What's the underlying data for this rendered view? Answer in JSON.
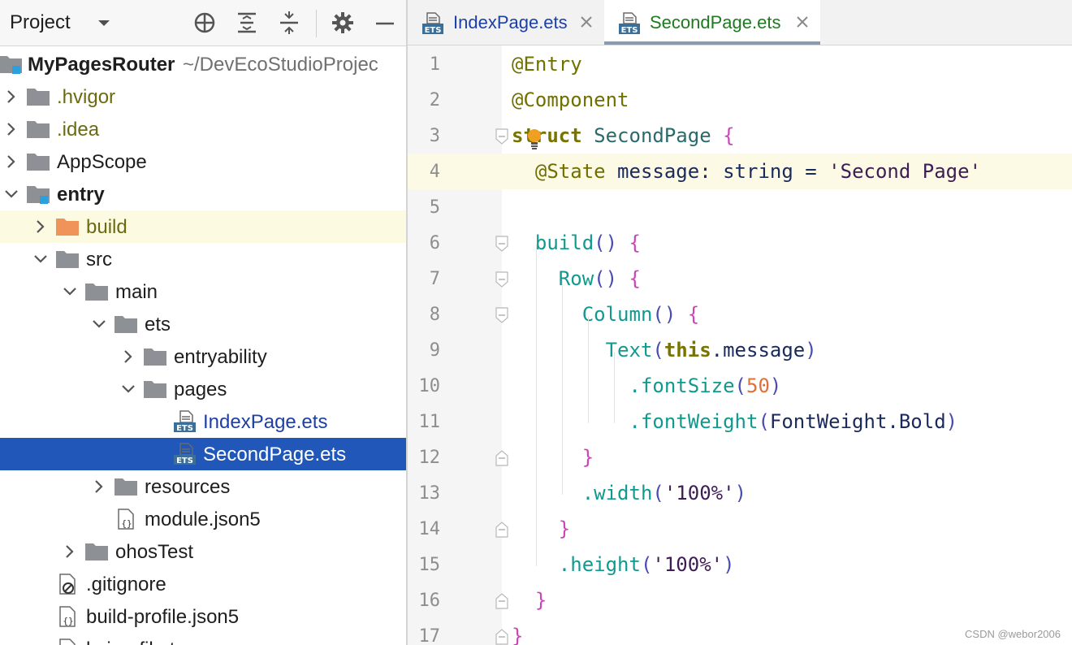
{
  "project_panel": {
    "title": "Project",
    "header_icons": [
      "crosshair-icon",
      "expand-all-icon",
      "collapse-all-icon",
      "gear-icon",
      "minimize-icon"
    ],
    "tree": [
      {
        "label": "MyPagesRouter",
        "path": "~/DevEcoStudioProjec",
        "depth": 0,
        "expanded": true,
        "icon": "module-folder-icon",
        "style": "bold"
      },
      {
        "label": ".hvigor",
        "depth": 1,
        "expanded": false,
        "icon": "folder-icon",
        "style": "olive"
      },
      {
        "label": ".idea",
        "depth": 1,
        "expanded": false,
        "icon": "folder-icon",
        "style": "olive"
      },
      {
        "label": "AppScope",
        "depth": 1,
        "expanded": false,
        "icon": "folder-icon",
        "style": "normal"
      },
      {
        "label": "entry",
        "depth": 1,
        "expanded": true,
        "icon": "module-folder-icon",
        "style": "bold"
      },
      {
        "label": "build",
        "depth": 2,
        "expanded": false,
        "icon": "build-folder-icon",
        "style": "olive",
        "highlight": true
      },
      {
        "label": "src",
        "depth": 2,
        "expanded": true,
        "icon": "folder-icon",
        "style": "normal"
      },
      {
        "label": "main",
        "depth": 3,
        "expanded": true,
        "icon": "folder-icon",
        "style": "normal"
      },
      {
        "label": "ets",
        "depth": 4,
        "expanded": true,
        "icon": "folder-icon",
        "style": "normal"
      },
      {
        "label": "entryability",
        "depth": 5,
        "expanded": false,
        "icon": "folder-icon",
        "style": "normal"
      },
      {
        "label": "pages",
        "depth": 5,
        "expanded": true,
        "icon": "folder-icon",
        "style": "normal"
      },
      {
        "label": "IndexPage.ets",
        "depth": 6,
        "icon": "ets-file-icon",
        "style": "blue"
      },
      {
        "label": "SecondPage.ets",
        "depth": 6,
        "icon": "ets-file-icon",
        "style": "normal",
        "selected": true
      },
      {
        "label": "resources",
        "depth": 4,
        "expanded": false,
        "icon": "folder-icon",
        "style": "normal"
      },
      {
        "label": "module.json5",
        "depth": 4,
        "icon": "json-file-icon",
        "style": "normal"
      },
      {
        "label": "ohosTest",
        "depth": 3,
        "expanded": false,
        "icon": "folder-icon",
        "style": "normal"
      },
      {
        "label": ".gitignore",
        "depth": 2,
        "icon": "gitignore-file-icon",
        "style": "normal"
      },
      {
        "label": "build-profile.json5",
        "depth": 2,
        "icon": "json-file-icon",
        "style": "normal"
      },
      {
        "label": "hvigorfile.ts",
        "depth": 2,
        "icon": "file-icon",
        "style": "normal"
      }
    ]
  },
  "editor": {
    "tabs": [
      {
        "label": "IndexPage.ets",
        "active": false
      },
      {
        "label": "SecondPage.ets",
        "active": true
      }
    ],
    "current_line": 4,
    "lines": [
      {
        "n": "1",
        "tokens": [
          [
            "dec",
            "@Entry"
          ]
        ]
      },
      {
        "n": "2",
        "tokens": [
          [
            "dec",
            "@Component"
          ]
        ]
      },
      {
        "n": "3",
        "fold": "open",
        "tokens": [
          [
            "kw",
            "struct"
          ],
          [
            "id",
            " "
          ],
          [
            "type",
            "SecondPage"
          ],
          [
            "id",
            " "
          ],
          [
            "br",
            "{"
          ]
        ]
      },
      {
        "n": "4",
        "tokens": [
          [
            "id",
            "  "
          ],
          [
            "dec",
            "@State"
          ],
          [
            "id",
            " message: "
          ],
          [
            "kw2",
            "string"
          ],
          [
            "id",
            " = "
          ],
          [
            "str",
            "'Second Page'"
          ]
        ]
      },
      {
        "n": "5",
        "tokens": []
      },
      {
        "n": "6",
        "fold": "open",
        "tokens": [
          [
            "id",
            "  "
          ],
          [
            "fn",
            "build"
          ],
          [
            "p",
            "()"
          ],
          [
            "id",
            " "
          ],
          [
            "br",
            "{"
          ]
        ]
      },
      {
        "n": "7",
        "fold": "open",
        "tokens": [
          [
            "id",
            "    "
          ],
          [
            "fn",
            "Row"
          ],
          [
            "p",
            "()"
          ],
          [
            "id",
            " "
          ],
          [
            "br",
            "{"
          ]
        ]
      },
      {
        "n": "8",
        "fold": "open",
        "tokens": [
          [
            "id",
            "      "
          ],
          [
            "fn",
            "Column"
          ],
          [
            "p",
            "()"
          ],
          [
            "id",
            " "
          ],
          [
            "br",
            "{"
          ]
        ]
      },
      {
        "n": "9",
        "tokens": [
          [
            "id",
            "        "
          ],
          [
            "fn",
            "Text"
          ],
          [
            "p",
            "("
          ],
          [
            "kw",
            "this"
          ],
          [
            "id",
            ".message"
          ],
          [
            "p",
            ")"
          ]
        ]
      },
      {
        "n": "10",
        "tokens": [
          [
            "id",
            "          "
          ],
          [
            "fn",
            ".fontSize"
          ],
          [
            "p",
            "("
          ],
          [
            "num",
            "50"
          ],
          [
            "p",
            ")"
          ]
        ]
      },
      {
        "n": "11",
        "tokens": [
          [
            "id",
            "          "
          ],
          [
            "fn",
            ".fontWeight"
          ],
          [
            "p",
            "("
          ],
          [
            "id",
            "FontWeight.Bold"
          ],
          [
            "p",
            ")"
          ]
        ]
      },
      {
        "n": "12",
        "fold": "close",
        "tokens": [
          [
            "id",
            "      "
          ],
          [
            "br",
            "}"
          ]
        ]
      },
      {
        "n": "13",
        "tokens": [
          [
            "id",
            "      "
          ],
          [
            "fn",
            ".width"
          ],
          [
            "p",
            "("
          ],
          [
            "str",
            "'100%'"
          ],
          [
            "p",
            ")"
          ]
        ]
      },
      {
        "n": "14",
        "fold": "close",
        "tokens": [
          [
            "id",
            "    "
          ],
          [
            "br",
            "}"
          ]
        ]
      },
      {
        "n": "15",
        "tokens": [
          [
            "id",
            "    "
          ],
          [
            "fn",
            ".height"
          ],
          [
            "p",
            "("
          ],
          [
            "str",
            "'100%'"
          ],
          [
            "p",
            ")"
          ]
        ]
      },
      {
        "n": "16",
        "fold": "close",
        "tokens": [
          [
            "id",
            "  "
          ],
          [
            "br",
            "}"
          ]
        ]
      },
      {
        "n": "17",
        "fold": "close",
        "tokens": [
          [
            "br",
            "}"
          ]
        ]
      }
    ]
  },
  "watermark": "CSDN @webor2006"
}
